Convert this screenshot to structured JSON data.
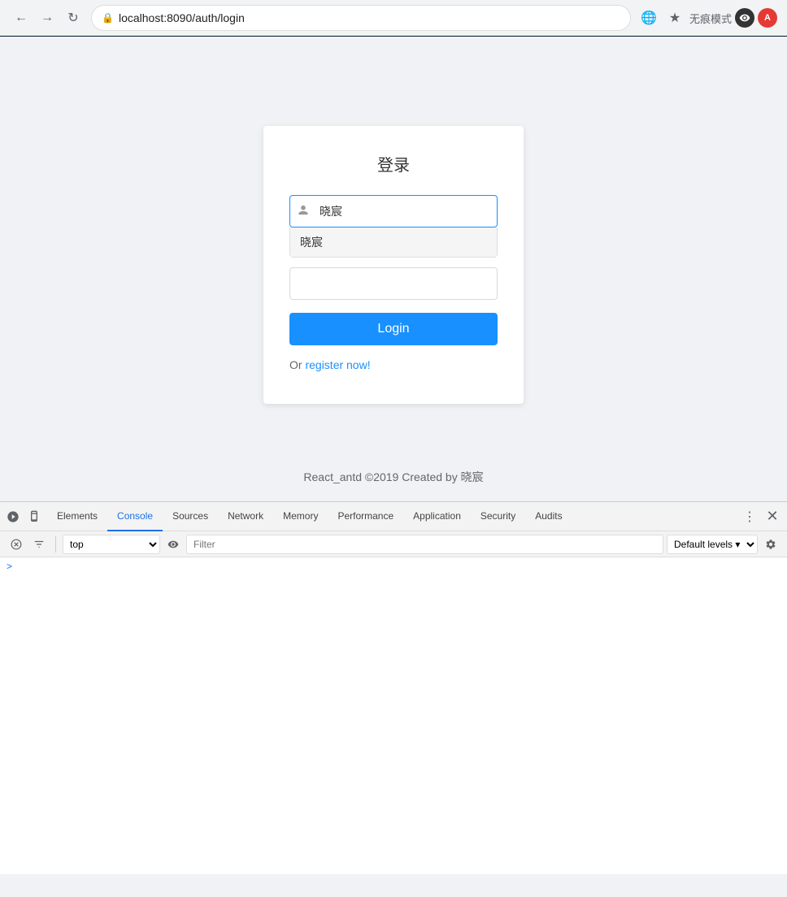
{
  "browser": {
    "url": "localhost:8090/auth/login",
    "incognito_label": "无痕模式",
    "back_disabled": false,
    "forward_disabled": false
  },
  "page": {
    "header_bg": "#001529",
    "login_card": {
      "title": "登录",
      "username_placeholder": "晓宸",
      "username_value": "晓宸",
      "autocomplete_option": "晓宸",
      "login_button": "Login",
      "or_text": "Or",
      "register_link": "register now!"
    },
    "footer": "React_antd ©2019 Created by 晓宸"
  },
  "devtools": {
    "tabs": [
      {
        "label": "Elements",
        "active": false
      },
      {
        "label": "Console",
        "active": true
      },
      {
        "label": "Sources",
        "active": false
      },
      {
        "label": "Network",
        "active": false
      },
      {
        "label": "Memory",
        "active": false
      },
      {
        "label": "Performance",
        "active": false
      },
      {
        "label": "Application",
        "active": false
      },
      {
        "label": "Security",
        "active": false
      },
      {
        "label": "Audits",
        "active": false
      }
    ],
    "context_selector": "top",
    "filter_placeholder": "Filter",
    "levels_label": "Default levels",
    "levels_arrow": "▾",
    "console_prompt": ">"
  }
}
